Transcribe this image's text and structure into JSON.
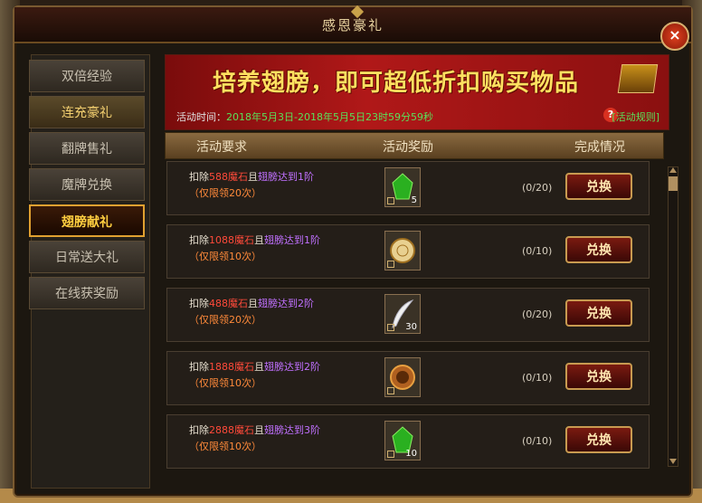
{
  "window": {
    "title": "感恩豪礼",
    "close_label": "×"
  },
  "sidebar": {
    "items": [
      {
        "label": "双倍经验",
        "state": "normal"
      },
      {
        "label": "连充豪礼",
        "state": "gold"
      },
      {
        "label": "翻牌售礼",
        "state": "normal"
      },
      {
        "label": "魔牌兑换",
        "state": "normal"
      },
      {
        "label": "翅膀献礼",
        "state": "active"
      },
      {
        "label": "日常送大礼",
        "state": "normal"
      },
      {
        "label": "在线获奖励",
        "state": "normal"
      }
    ]
  },
  "banner": {
    "headline": "培养翅膀，即可超低折扣购买物品",
    "time_label": "活动时间：",
    "time_value": "2018年5月3日-2018年5月5日23时59分59秒",
    "help_icon": "?",
    "rules_label": "[活动规则]"
  },
  "table": {
    "headers": [
      "活动要求",
      "活动奖励",
      "完成情况"
    ],
    "rows": [
      {
        "req_prefix": "扣除",
        "cost": "588魔石",
        "req_mid": "且",
        "wing": "翅膀达到1阶",
        "limit": "（仅限领20次）",
        "item_icon": "green-gem-icon",
        "item_count": "5",
        "progress": "(0/20)",
        "button": "兑换"
      },
      {
        "req_prefix": "扣除",
        "cost": "1088魔石",
        "req_mid": "且",
        "wing": "翅膀达到1阶",
        "limit": "（仅限领10次）",
        "item_icon": "gold-coin-icon",
        "item_count": "",
        "progress": "(0/10)",
        "button": "兑换"
      },
      {
        "req_prefix": "扣除",
        "cost": "488魔石",
        "req_mid": "且",
        "wing": "翅膀达到2阶",
        "limit": "（仅限领20次）",
        "item_icon": "feather-icon",
        "item_count": "30",
        "progress": "(0/20)",
        "button": "兑换"
      },
      {
        "req_prefix": "扣除",
        "cost": "1888魔石",
        "req_mid": "且",
        "wing": "翅膀达到2阶",
        "limit": "（仅限领10次）",
        "item_icon": "bronze-ring-icon",
        "item_count": "",
        "progress": "(0/10)",
        "button": "兑换"
      },
      {
        "req_prefix": "扣除",
        "cost": "2888魔石",
        "req_mid": "且",
        "wing": "翅膀达到3阶",
        "limit": "（仅限领10次）",
        "item_icon": "green-gem-icon",
        "item_count": "10",
        "progress": "(0/10)",
        "button": "兑换"
      }
    ]
  }
}
